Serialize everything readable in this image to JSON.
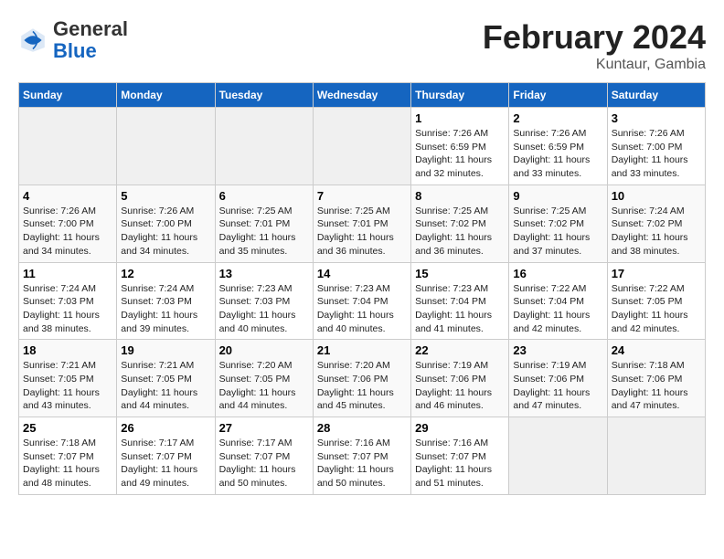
{
  "header": {
    "logo_general": "General",
    "logo_blue": "Blue",
    "title": "February 2024",
    "location": "Kuntaur, Gambia"
  },
  "weekdays": [
    "Sunday",
    "Monday",
    "Tuesday",
    "Wednesday",
    "Thursday",
    "Friday",
    "Saturday"
  ],
  "weeks": [
    [
      {
        "day": "",
        "info": ""
      },
      {
        "day": "",
        "info": ""
      },
      {
        "day": "",
        "info": ""
      },
      {
        "day": "",
        "info": ""
      },
      {
        "day": "1",
        "info": "Sunrise: 7:26 AM\nSunset: 6:59 PM\nDaylight: 11 hours\nand 32 minutes."
      },
      {
        "day": "2",
        "info": "Sunrise: 7:26 AM\nSunset: 6:59 PM\nDaylight: 11 hours\nand 33 minutes."
      },
      {
        "day": "3",
        "info": "Sunrise: 7:26 AM\nSunset: 7:00 PM\nDaylight: 11 hours\nand 33 minutes."
      }
    ],
    [
      {
        "day": "4",
        "info": "Sunrise: 7:26 AM\nSunset: 7:00 PM\nDaylight: 11 hours\nand 34 minutes."
      },
      {
        "day": "5",
        "info": "Sunrise: 7:26 AM\nSunset: 7:00 PM\nDaylight: 11 hours\nand 34 minutes."
      },
      {
        "day": "6",
        "info": "Sunrise: 7:25 AM\nSunset: 7:01 PM\nDaylight: 11 hours\nand 35 minutes."
      },
      {
        "day": "7",
        "info": "Sunrise: 7:25 AM\nSunset: 7:01 PM\nDaylight: 11 hours\nand 36 minutes."
      },
      {
        "day": "8",
        "info": "Sunrise: 7:25 AM\nSunset: 7:02 PM\nDaylight: 11 hours\nand 36 minutes."
      },
      {
        "day": "9",
        "info": "Sunrise: 7:25 AM\nSunset: 7:02 PM\nDaylight: 11 hours\nand 37 minutes."
      },
      {
        "day": "10",
        "info": "Sunrise: 7:24 AM\nSunset: 7:02 PM\nDaylight: 11 hours\nand 38 minutes."
      }
    ],
    [
      {
        "day": "11",
        "info": "Sunrise: 7:24 AM\nSunset: 7:03 PM\nDaylight: 11 hours\nand 38 minutes."
      },
      {
        "day": "12",
        "info": "Sunrise: 7:24 AM\nSunset: 7:03 PM\nDaylight: 11 hours\nand 39 minutes."
      },
      {
        "day": "13",
        "info": "Sunrise: 7:23 AM\nSunset: 7:03 PM\nDaylight: 11 hours\nand 40 minutes."
      },
      {
        "day": "14",
        "info": "Sunrise: 7:23 AM\nSunset: 7:04 PM\nDaylight: 11 hours\nand 40 minutes."
      },
      {
        "day": "15",
        "info": "Sunrise: 7:23 AM\nSunset: 7:04 PM\nDaylight: 11 hours\nand 41 minutes."
      },
      {
        "day": "16",
        "info": "Sunrise: 7:22 AM\nSunset: 7:04 PM\nDaylight: 11 hours\nand 42 minutes."
      },
      {
        "day": "17",
        "info": "Sunrise: 7:22 AM\nSunset: 7:05 PM\nDaylight: 11 hours\nand 42 minutes."
      }
    ],
    [
      {
        "day": "18",
        "info": "Sunrise: 7:21 AM\nSunset: 7:05 PM\nDaylight: 11 hours\nand 43 minutes."
      },
      {
        "day": "19",
        "info": "Sunrise: 7:21 AM\nSunset: 7:05 PM\nDaylight: 11 hours\nand 44 minutes."
      },
      {
        "day": "20",
        "info": "Sunrise: 7:20 AM\nSunset: 7:05 PM\nDaylight: 11 hours\nand 44 minutes."
      },
      {
        "day": "21",
        "info": "Sunrise: 7:20 AM\nSunset: 7:06 PM\nDaylight: 11 hours\nand 45 minutes."
      },
      {
        "day": "22",
        "info": "Sunrise: 7:19 AM\nSunset: 7:06 PM\nDaylight: 11 hours\nand 46 minutes."
      },
      {
        "day": "23",
        "info": "Sunrise: 7:19 AM\nSunset: 7:06 PM\nDaylight: 11 hours\nand 47 minutes."
      },
      {
        "day": "24",
        "info": "Sunrise: 7:18 AM\nSunset: 7:06 PM\nDaylight: 11 hours\nand 47 minutes."
      }
    ],
    [
      {
        "day": "25",
        "info": "Sunrise: 7:18 AM\nSunset: 7:07 PM\nDaylight: 11 hours\nand 48 minutes."
      },
      {
        "day": "26",
        "info": "Sunrise: 7:17 AM\nSunset: 7:07 PM\nDaylight: 11 hours\nand 49 minutes."
      },
      {
        "day": "27",
        "info": "Sunrise: 7:17 AM\nSunset: 7:07 PM\nDaylight: 11 hours\nand 50 minutes."
      },
      {
        "day": "28",
        "info": "Sunrise: 7:16 AM\nSunset: 7:07 PM\nDaylight: 11 hours\nand 50 minutes."
      },
      {
        "day": "29",
        "info": "Sunrise: 7:16 AM\nSunset: 7:07 PM\nDaylight: 11 hours\nand 51 minutes."
      },
      {
        "day": "",
        "info": ""
      },
      {
        "day": "",
        "info": ""
      }
    ]
  ]
}
